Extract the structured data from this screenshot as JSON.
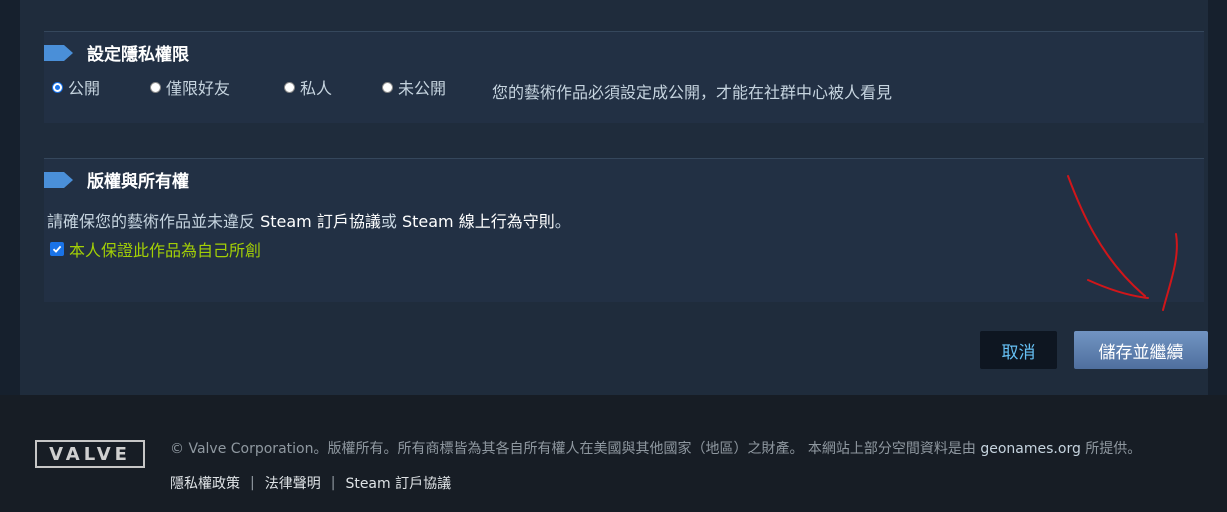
{
  "privacy": {
    "title": "設定隱私權限",
    "options": [
      {
        "label": "公開",
        "checked": true
      },
      {
        "label": "僅限好友",
        "checked": false
      },
      {
        "label": "私人",
        "checked": false
      },
      {
        "label": "未公開",
        "checked": false
      }
    ],
    "note": "您的藝術作品必須設定成公開，才能在社群中心被人看見"
  },
  "copyright": {
    "title": "版權與所有權",
    "text_before": "請確保您的藝術作品並未違反 ",
    "link_ssa": "Steam 訂戶協議",
    "text_mid": "或 ",
    "link_conduct": "Steam 線上行為守則",
    "text_after": "。",
    "agree_label": "本人保證此作品為自己所創",
    "agree_checked": true
  },
  "buttons": {
    "cancel": "取消",
    "save": "儲存並繼續"
  },
  "footer": {
    "logo": "VALVE",
    "copyright_a": "© Valve Corporation。版權所有。所有商標皆為其各自所有權人在美國與其他國家（地區）之財產。 本網站上部分空間資料是由 ",
    "geonames": "geonames.org",
    "copyright_b": " 所提供。",
    "links": [
      "隱私權政策",
      "法律聲明",
      "Steam 訂戶協議"
    ]
  },
  "colors": {
    "accent_link": "#66c0f4",
    "agree_green": "#a3cf06",
    "tag_blue": "#4a8fd8"
  }
}
